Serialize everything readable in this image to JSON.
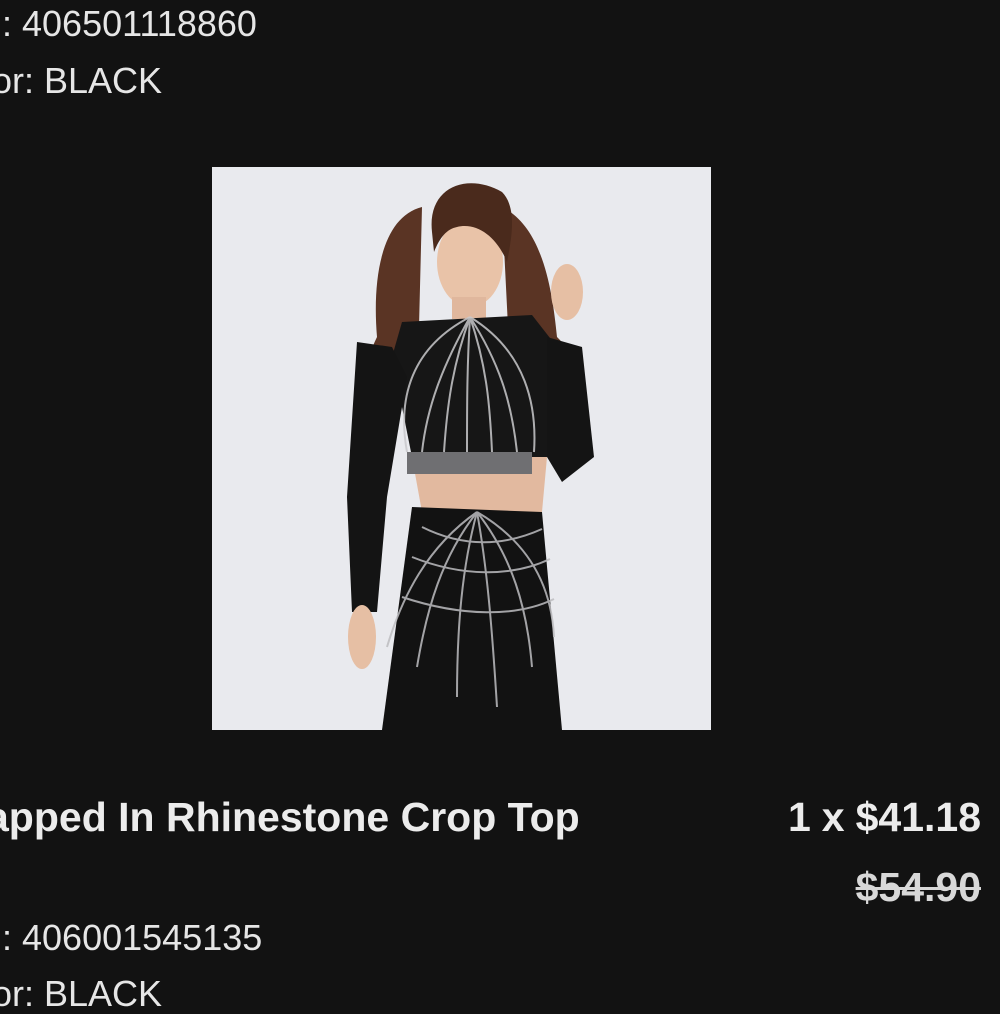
{
  "items": [
    {
      "sku_label": "ı: ",
      "sku": "406501118860",
      "color_label": "or: ",
      "color": "BLACK"
    },
    {
      "title": "apped In Rhinestone Crop Top",
      "quantity": "1",
      "quantity_sep": "x",
      "price": "$41.18",
      "original_price": "$54.90",
      "sku_label": "ı: ",
      "sku": "406001545135",
      "color_label": "or: ",
      "color": "BLACK"
    }
  ],
  "colors": {
    "background": "#121212",
    "text": "#e8e8e8",
    "image_bg": "#e9eaee"
  },
  "icons": {
    "product_image": "product-photo"
  }
}
